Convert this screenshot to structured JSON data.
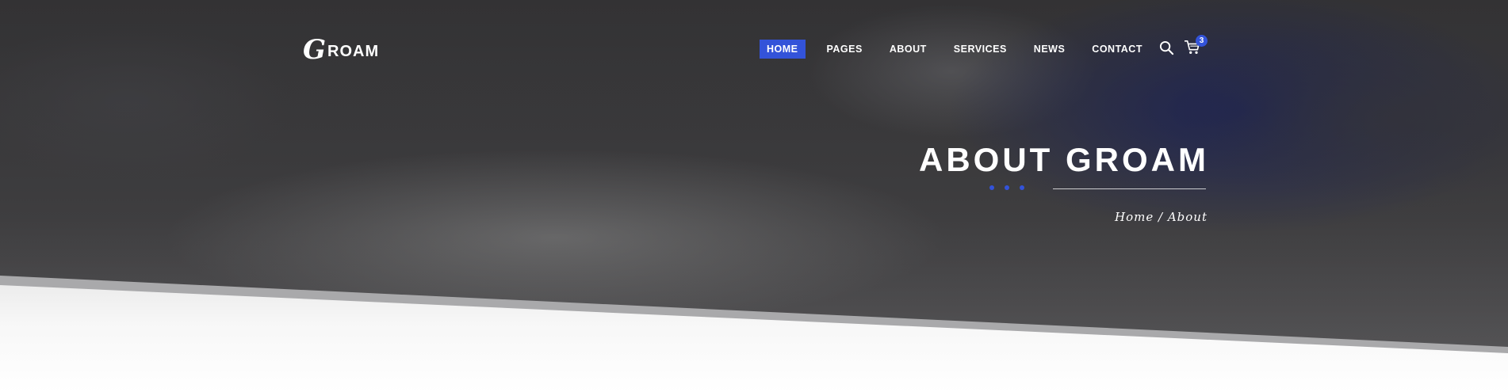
{
  "brand": {
    "logo_mark": "G",
    "logo_text": "ROAM"
  },
  "nav": {
    "items": [
      {
        "label": "HOME",
        "active": true
      },
      {
        "label": "PAGES"
      },
      {
        "label": "ABOUT"
      },
      {
        "label": "SERVICES"
      },
      {
        "label": "NEWS"
      },
      {
        "label": "CONTACT"
      }
    ],
    "cart_count": "3",
    "icons": [
      "search-icon",
      "cart-icon"
    ]
  },
  "hero": {
    "title": "ABOUT GROAM",
    "breadcrumb": "Home / About"
  },
  "colors": {
    "accent": "#3353d9",
    "text": "#ffffff",
    "overlay": "#3e3d3f"
  }
}
